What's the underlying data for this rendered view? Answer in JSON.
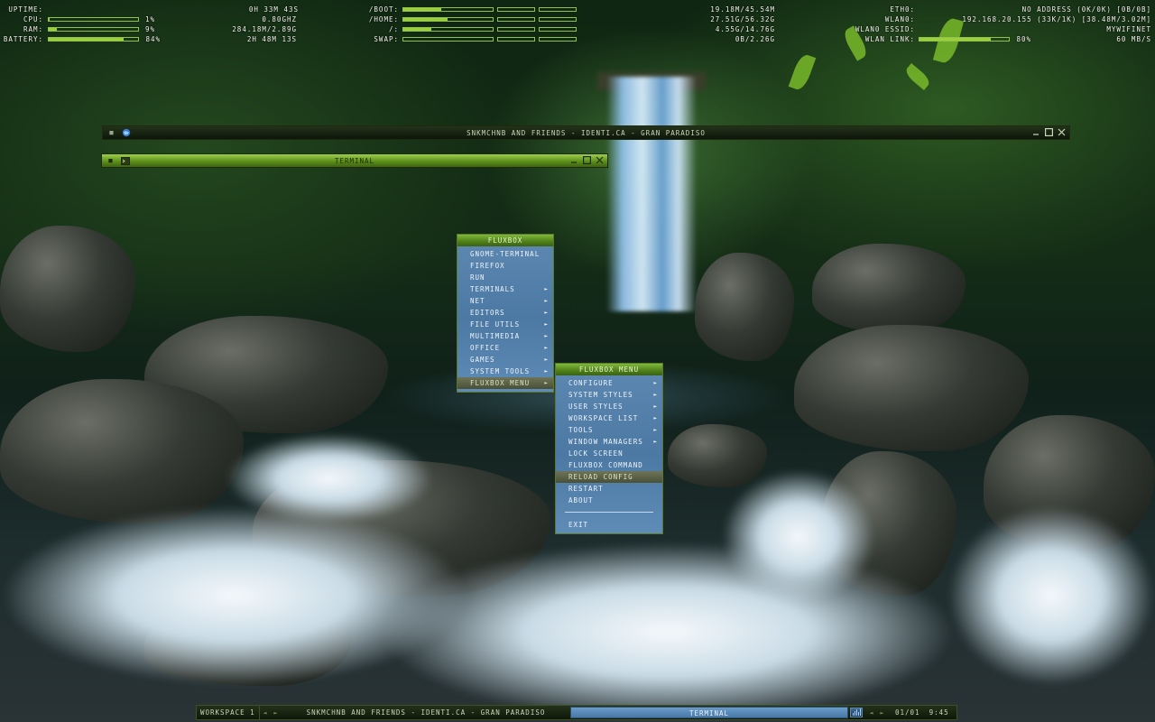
{
  "conky": {
    "system": [
      {
        "label": "UPTIME:",
        "value": "0H 33M 43S"
      },
      {
        "label": "CPU:",
        "value": "1%",
        "extra": "0.80GHZ",
        "fill": 0.01
      },
      {
        "label": "RAM:",
        "value": "9%",
        "extra": "284.18M/2.89G",
        "fill": 0.09
      },
      {
        "label": "BATTERY:",
        "value": "84%",
        "extra": "2H 48M 13S",
        "fill": 0.84
      }
    ],
    "disks": [
      {
        "label": "/BOOT:",
        "value": "19.18M/45.54M",
        "fill": 0.42
      },
      {
        "label": "/HOME:",
        "value": "27.51G/56.32G",
        "fill": 0.49
      },
      {
        "label": "/:",
        "value": "4.55G/14.76G",
        "fill": 0.31
      },
      {
        "label": "SWAP:",
        "value": "0B/2.26G",
        "fill": 0.0
      }
    ],
    "network": [
      {
        "label": "ETH0:",
        "value": "NO ADDRESS (0K/0K) [0B/0B]"
      },
      {
        "label": "WLAN0:",
        "value": "192.168.20.155 (33K/1K) [38.48M/3.02M]"
      },
      {
        "label": "WLAN0 ESSID:",
        "value": "MYWIFINET"
      },
      {
        "label": "WLAN LINK:",
        "value": "80%",
        "extra": "60 MB/S",
        "fill": 0.8
      }
    ]
  },
  "windows": {
    "browser": {
      "title": "SNKMCHNB AND FRIENDS - IDENTI.CA - GRAN PARADISO",
      "icon": "globe-icon"
    },
    "terminal": {
      "title": "TERMINAL",
      "icon": "terminal-icon"
    }
  },
  "menus": {
    "main": {
      "title": "FLUXBOX",
      "items": [
        {
          "label": "GNOME-TERMINAL",
          "submenu": false
        },
        {
          "label": "FIREFOX",
          "submenu": false
        },
        {
          "label": "RUN",
          "submenu": false
        },
        {
          "label": "TERMINALS",
          "submenu": true
        },
        {
          "label": "NET",
          "submenu": true
        },
        {
          "label": "EDITORS",
          "submenu": true
        },
        {
          "label": "FILE UTILS",
          "submenu": true
        },
        {
          "label": "MULTIMEDIA",
          "submenu": true
        },
        {
          "label": "OFFICE",
          "submenu": true
        },
        {
          "label": "GAMES",
          "submenu": true
        },
        {
          "label": "SYSTEM TOOLS",
          "submenu": true
        },
        {
          "label": "FLUXBOX MENU",
          "submenu": true,
          "highlighted": true
        }
      ]
    },
    "sub": {
      "title": "FLUXBOX MENU",
      "items": [
        {
          "label": "CONFIGURE",
          "submenu": true
        },
        {
          "label": "SYSTEM STYLES",
          "submenu": true
        },
        {
          "label": "USER STYLES",
          "submenu": true
        },
        {
          "label": "WORKSPACE LIST",
          "submenu": true
        },
        {
          "label": "TOOLS",
          "submenu": true
        },
        {
          "label": "WINDOW MANAGERS",
          "submenu": true
        },
        {
          "label": "LOCK SCREEN",
          "submenu": false
        },
        {
          "label": "FLUXBOX COMMAND",
          "submenu": false
        },
        {
          "label": "RELOAD CONFIG",
          "submenu": false,
          "highlighted": true
        },
        {
          "label": "RESTART",
          "submenu": false
        },
        {
          "label": "ABOUT",
          "submenu": false
        },
        {
          "separator": true
        },
        {
          "label": "EXIT",
          "submenu": false
        }
      ]
    }
  },
  "toolbar": {
    "workspace": "WORKSPACE 1",
    "tasks": [
      {
        "label": "SNKMCHNB AND FRIENDS - IDENTI.CA - GRAN PARADISO",
        "focused": false
      },
      {
        "label": "TERMINAL",
        "focused": true
      }
    ],
    "date": "01/01",
    "time": "9:45"
  },
  "colors": {
    "accent_green": "#9ccf3c",
    "menu_blue": "#4c79a3",
    "titlebar_dark": "#0d160a"
  }
}
